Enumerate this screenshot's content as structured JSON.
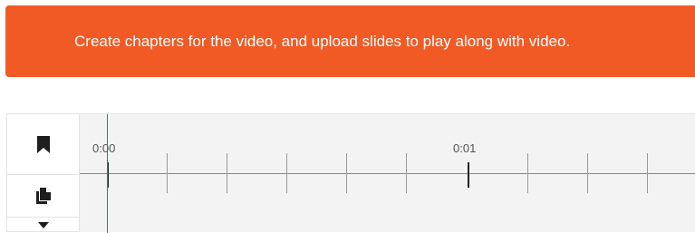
{
  "banner": {
    "text": "Create chapters for the video, and upload slides to play along with video.",
    "color": "#f15a25"
  },
  "toolbar": {
    "bookmark_icon": "bookmark-icon",
    "slides_icon": "documents-icon",
    "more_icon": "caret-down-icon"
  },
  "timeline": {
    "labels": [
      "0:00",
      "0:01"
    ],
    "playhead_color": "#ff2a2a",
    "playhead_time": "0:00"
  }
}
